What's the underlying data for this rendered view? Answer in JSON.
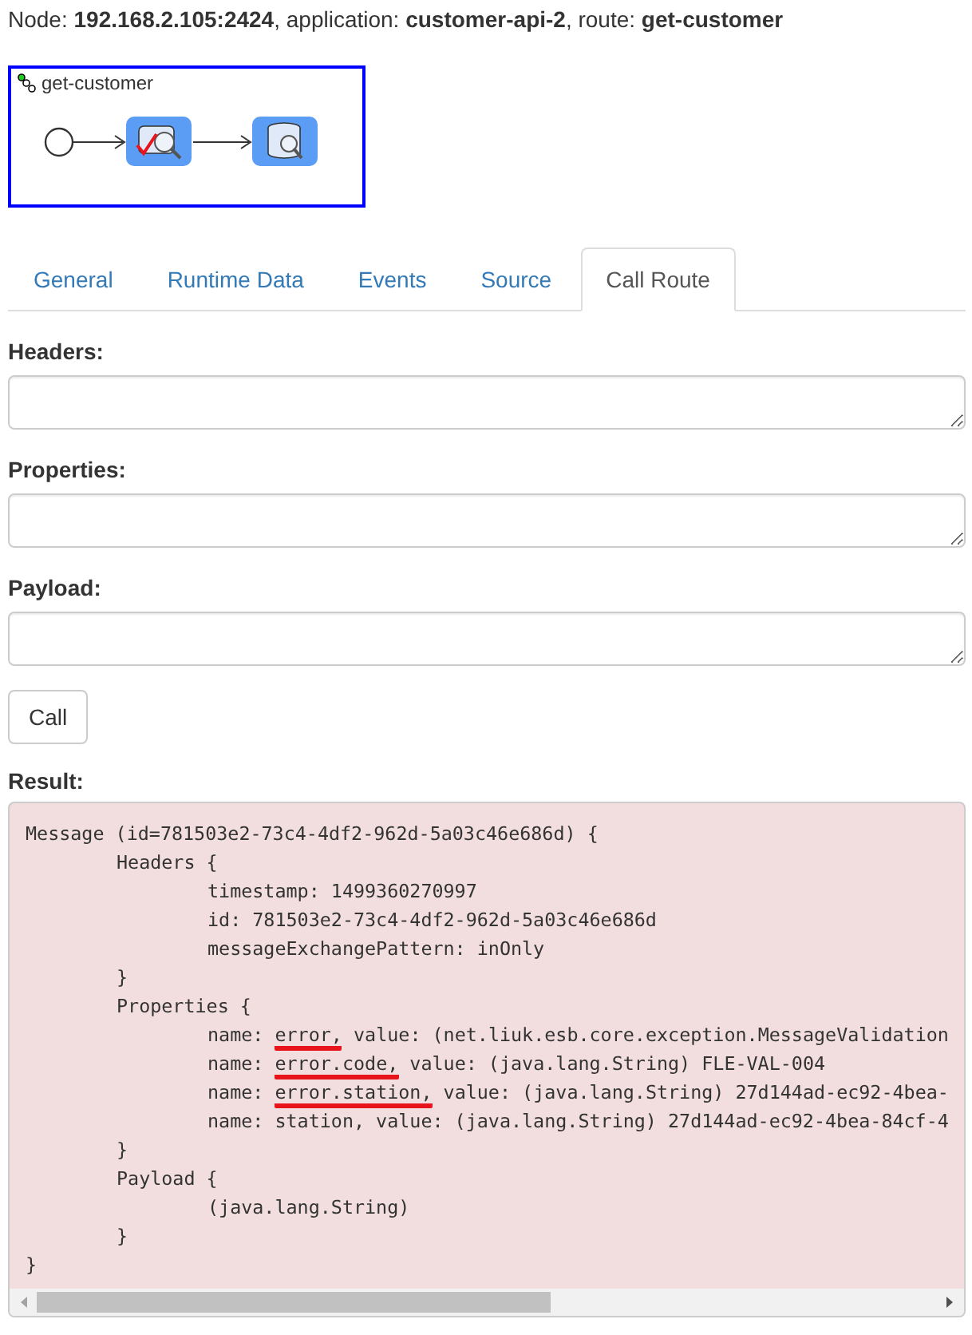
{
  "header": {
    "text": "Node: **192.168.2.105:2424**, application: **customer-api-2**, route: **get-customer**"
  },
  "diagram": {
    "title": "get-customer"
  },
  "tabs": [
    {
      "label": "General",
      "selected": false
    },
    {
      "label": "Runtime Data",
      "selected": false
    },
    {
      "label": "Events",
      "selected": false
    },
    {
      "label": "Source",
      "selected": false
    },
    {
      "label": "Call Route",
      "selected": true
    }
  ],
  "fields": [
    {
      "label": "Headers:"
    },
    {
      "label": "Properties:"
    },
    {
      "label": "Payload:"
    }
  ],
  "call_button": "Call",
  "result": {
    "label": "Result:",
    "output": {
      "parts": [
        {
          "text": "Message (id=781503e2-73c4-4df2-962d-5a03c46e686d) {"
        }
      ],
      "close": "}",
      "children": [
        {
          "parts": [
            {
              "text": "Headers {"
            }
          ],
          "close": "}",
          "children": [
            {
              "parts": [
                {
                  "text": "timestamp: 1499360270997"
                }
              ]
            },
            {
              "parts": [
                {
                  "text": "id: 781503e2-73c4-4df2-962d-5a03c46e686d"
                }
              ]
            },
            {
              "parts": [
                {
                  "text": "messageExchangePattern: inOnly"
                }
              ]
            }
          ]
        },
        {
          "parts": [
            {
              "text": "Properties {"
            }
          ],
          "close": "}",
          "children": [
            {
              "parts": [
                {
                  "text": "name: "
                },
                {
                  "text": "error,",
                  "underlined": true
                },
                {
                  "text": " value: (net.liuk.esb.core.exception.MessageValidation"
                }
              ]
            },
            {
              "parts": [
                {
                  "text": "name: "
                },
                {
                  "text": "error.code,",
                  "underlined": true
                },
                {
                  "text": " value: (java.lang.String) FLE-VAL-004"
                }
              ]
            },
            {
              "parts": [
                {
                  "text": "name: "
                },
                {
                  "text": "error.station,",
                  "underlined": true
                },
                {
                  "text": " value: (java.lang.String) 27d144ad-ec92-4bea-"
                }
              ]
            },
            {
              "parts": [
                {
                  "text": "name: station, value: (java.lang.String) 27d144ad-ec92-4bea-84cf-4"
                }
              ]
            }
          ]
        },
        {
          "parts": [
            {
              "text": "Payload {"
            }
          ],
          "close": "}",
          "children": [
            {
              "parts": [
                {
                  "text": "(java.lang.String)"
                }
              ]
            }
          ]
        }
      ]
    }
  }
}
